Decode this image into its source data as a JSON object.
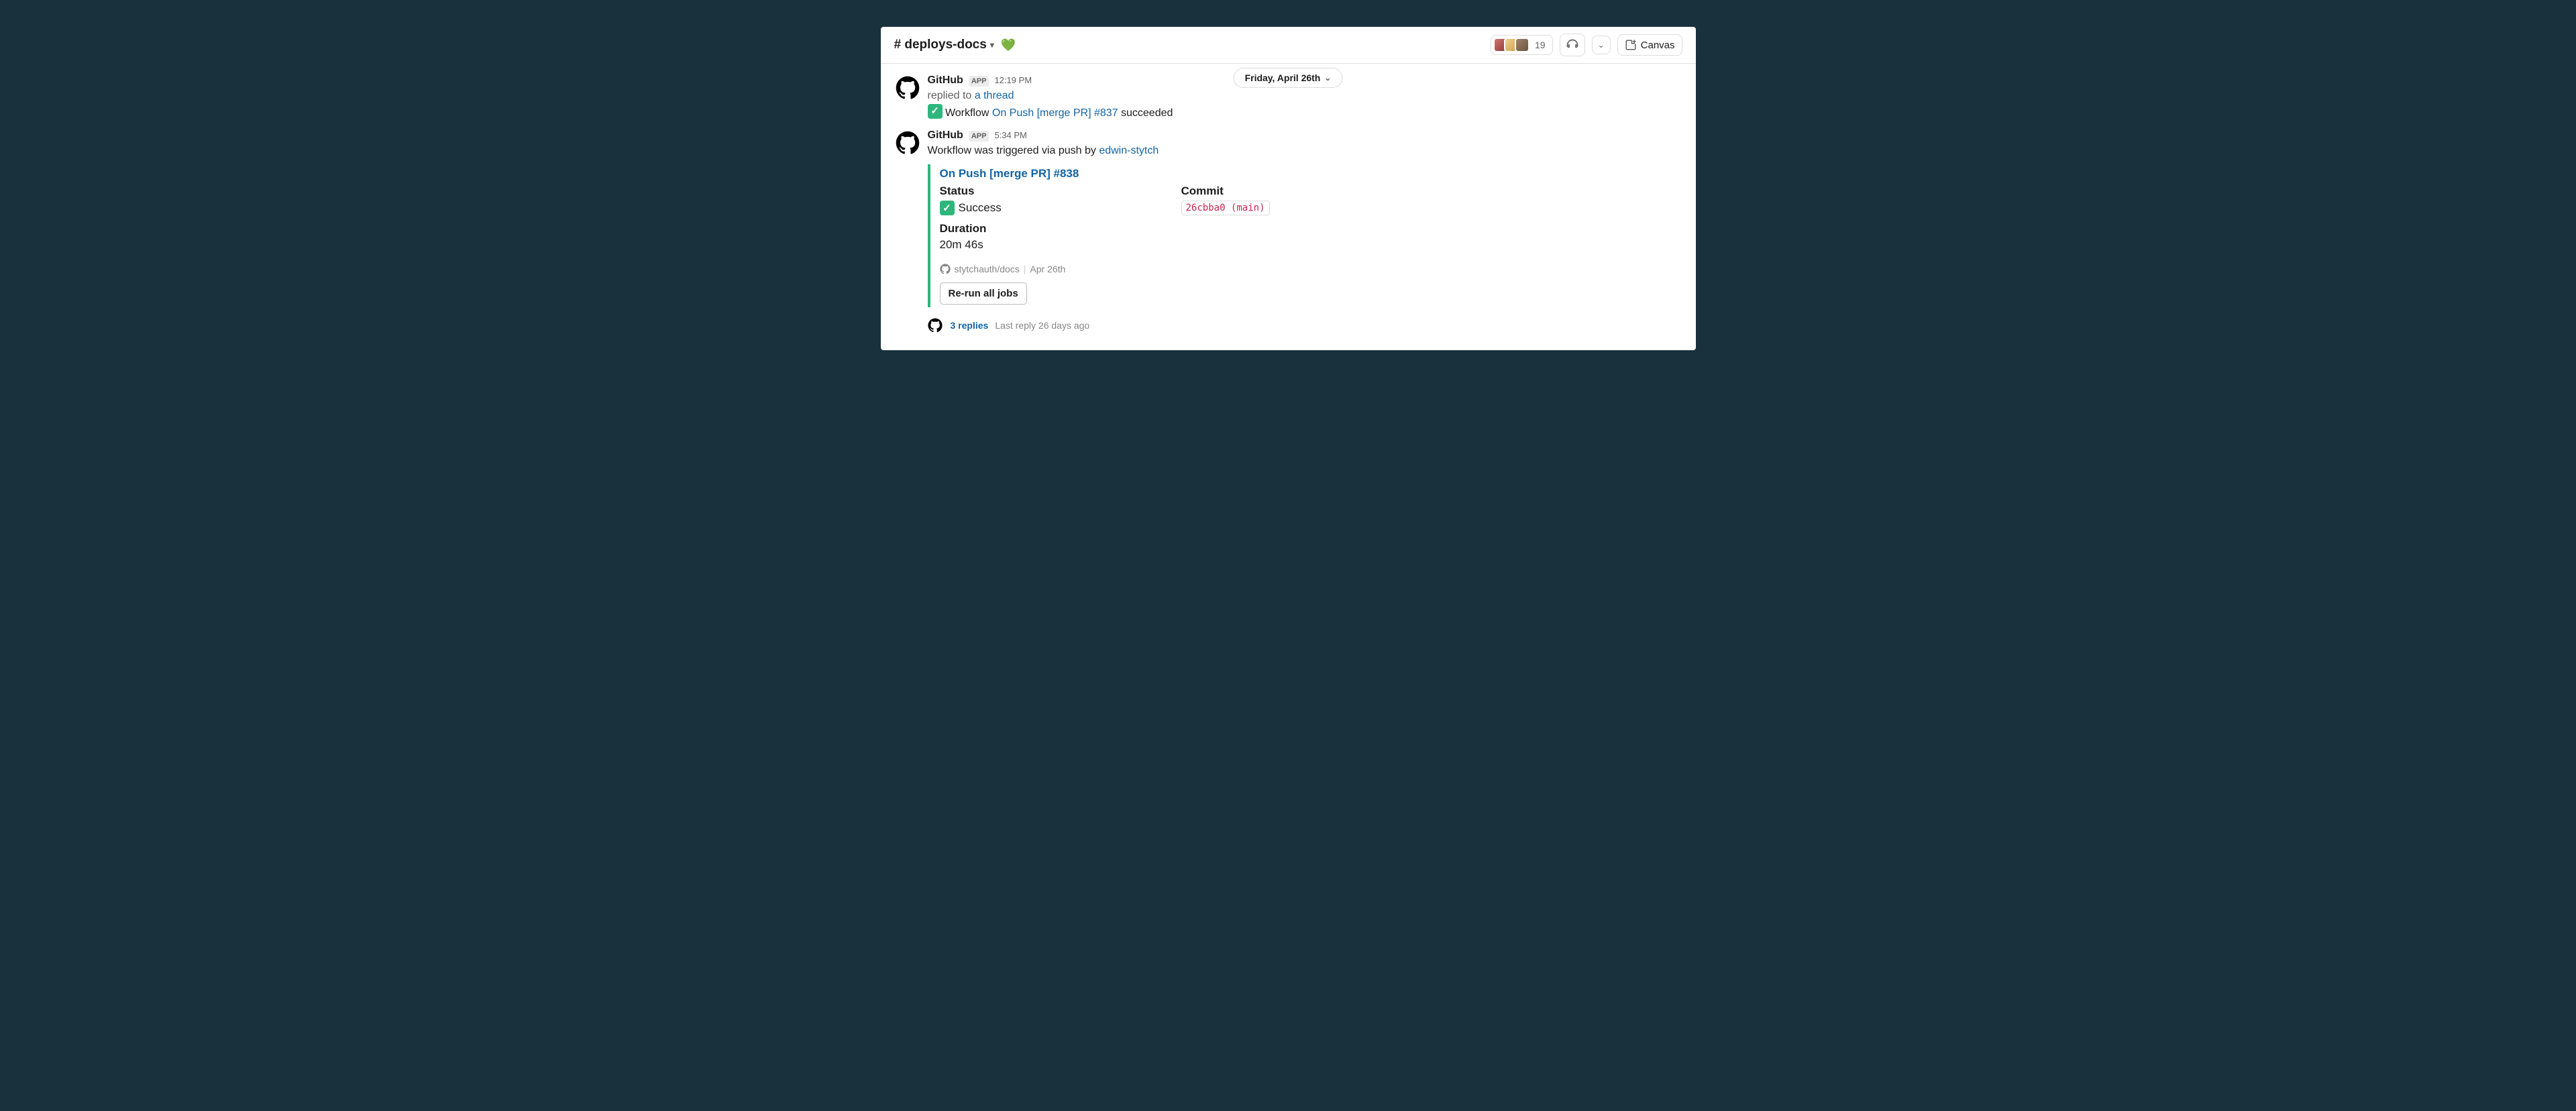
{
  "header": {
    "channel_name": "# deploys-docs",
    "heart": "💚",
    "member_count": "19",
    "canvas_label": "Canvas"
  },
  "date_divider": "Friday, April 26th",
  "messages": [
    {
      "sender": "GitHub",
      "badge": "APP",
      "time": "12:19 PM",
      "replied_prefix": "replied to ",
      "replied_link": "a thread",
      "line_prefix": " Workflow ",
      "workflow_link": "On Push [merge PR] #837",
      "line_suffix": " succeeded"
    },
    {
      "sender": "GitHub",
      "badge": "APP",
      "time": "5:34 PM",
      "line_prefix": "Workflow was triggered via push by ",
      "user_link": "edwin-stytch",
      "attachment": {
        "title": "On Push [merge PR] #838",
        "status_label": "Status",
        "status_value": " Success",
        "commit_label": "Commit",
        "commit_value": "26cbba0 (main)",
        "duration_label": "Duration",
        "duration_value": "20m 46s",
        "repo": "stytchauth/docs",
        "date": "Apr 26th",
        "rerun_label": "Re-run all jobs"
      }
    }
  ],
  "thread": {
    "replies": "3 replies",
    "last_reply": "Last reply 26 days ago"
  }
}
